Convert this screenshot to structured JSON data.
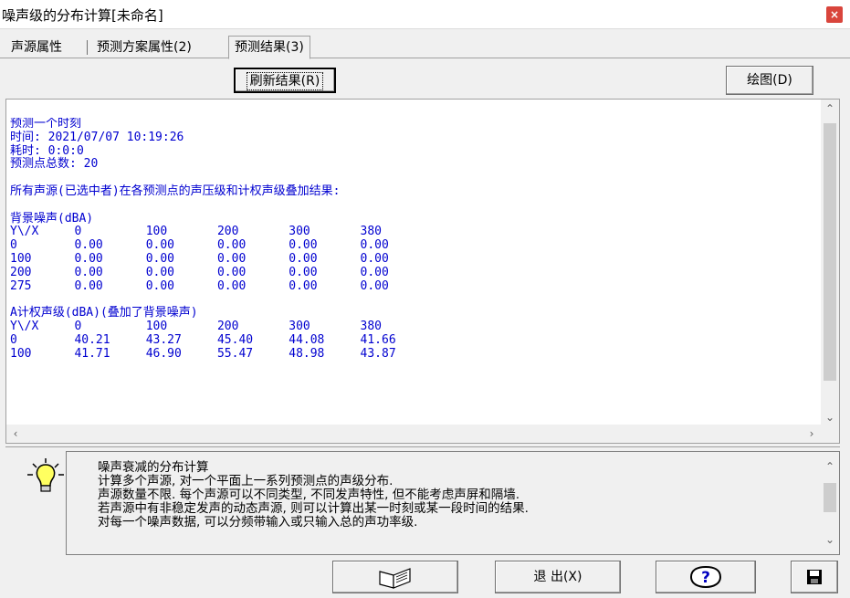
{
  "window": {
    "title": "噪声级的分布计算[未命名]",
    "close_label": "×"
  },
  "tabs": [
    {
      "label": "声源属性"
    },
    {
      "label": "预测方案属性(2)"
    },
    {
      "label": "预测结果(3)"
    }
  ],
  "toolbar": {
    "refresh_label": "刷新结果(R)",
    "draw_label": "绘图(D)"
  },
  "results": {
    "lines": [
      "预测一个时刻",
      "时间: 2021/07/07 10:19:26",
      "耗时: 0:0:0",
      "预测点总数: 20",
      "",
      "所有声源(已选中者)在各预测点的声压级和计权声级叠加结果:",
      "",
      "背景噪声(dBA)",
      "Y\\/X     0         100       200       300       380",
      "0        0.00      0.00      0.00      0.00      0.00",
      "100      0.00      0.00      0.00      0.00      0.00",
      "200      0.00      0.00      0.00      0.00      0.00",
      "275      0.00      0.00      0.00      0.00      0.00",
      "",
      "A计权声级(dBA)(叠加了背景噪声)",
      "Y\\/X     0         100       200       300       380",
      "0        40.21     43.27     45.40     44.08     41.66",
      "100      41.71     46.90     55.47     48.98     43.87"
    ]
  },
  "help": {
    "lines": [
      "噪声衰减的分布计算",
      "计算多个声源, 对一个平面上一系列预测点的声级分布.",
      "声源数量不限. 每个声源可以不同类型, 不同发声特性, 但不能考虑声屏和隔墙.",
      "若声源中有非稳定发声的动态声源, 则可以计算出某一时刻或某一段时间的结果.",
      "对每一个噪声数据, 可以分频带输入或只输入总的声功率级."
    ]
  },
  "footer": {
    "exit_label": "退 出(X)",
    "help_label": "?"
  },
  "icons": {
    "bulb": "lightbulb-icon",
    "book": "book-icon",
    "help": "help-icon",
    "save": "save-icon"
  },
  "colors": {
    "result_text": "#0000d0",
    "close_button": "#d9453c"
  }
}
